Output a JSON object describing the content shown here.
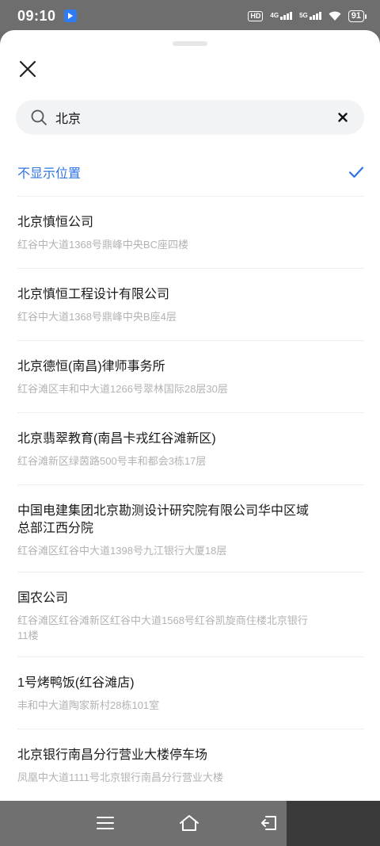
{
  "status_bar": {
    "time": "09:10",
    "hd_label": "HD",
    "net1_label": "4G",
    "net2_label": "5G",
    "battery": "91"
  },
  "search": {
    "value": "北京",
    "placeholder": ""
  },
  "no_location": {
    "label": "不显示位置"
  },
  "places": [
    {
      "name": "北京慎恒公司",
      "address": "红谷中大道1368号鼎峰中央BC座四楼"
    },
    {
      "name": "北京慎恒工程设计有限公司",
      "address": "红谷中大道1368号鼎峰中央B座4层"
    },
    {
      "name": "北京德恒(南昌)律师事务所",
      "address": "红谷滩区丰和中大道1266号翠林国际28层30层"
    },
    {
      "name": "北京翡翠教育(南昌卡戎红谷滩新区)",
      "address": "红谷滩新区绿茵路500号丰和都会3栋17层"
    },
    {
      "name": "中国电建集团北京勘测设计研究院有限公司华中区域总部江西分院",
      "address": "红谷滩区红谷中大道1398号九江银行大厦18层"
    },
    {
      "name": "国农公司",
      "address": "红谷滩区红谷滩新区红谷中大道1568号红谷凯旋商住楼北京银行11楼"
    },
    {
      "name": "1号烤鸭饭(红谷滩店)",
      "address": "丰和中大道陶家新村28栋101室"
    },
    {
      "name": "北京银行南昌分行营业大楼停车场",
      "address": "凤凰中大道1111号北京银行南昌分行营业大楼"
    }
  ],
  "colors": {
    "accent": "#2e74e6",
    "status_bar_bg": "#6e6e6e",
    "address_text": "#b3b3b3"
  }
}
